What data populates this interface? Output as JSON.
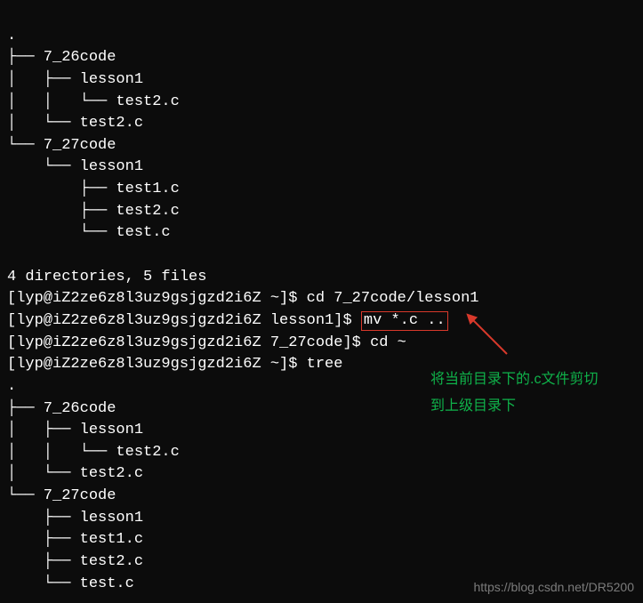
{
  "tree_top": {
    "root": ".",
    "lines": [
      "├── 7_26code",
      "│   ├── lesson1",
      "│   │   └── test2.c",
      "│   └── test2.c",
      "└── 7_27code",
      "    └── lesson1",
      "        ├── test1.c",
      "        ├── test2.c",
      "        └── test.c"
    ]
  },
  "summary1": "4 directories, 5 files",
  "prompt1_full": "[lyp@iZ2ze6z8l3uz9gsjgzd2i6Z ~]$ ",
  "cmd1": "cd 7_27code/lesson1",
  "prompt2_full": "[lyp@iZ2ze6z8l3uz9gsjgzd2i6Z lesson1]$ ",
  "cmd2": "mv *.c ..",
  "prompt3_full": "[lyp@iZ2ze6z8l3uz9gsjgzd2i6Z 7_27code]$ ",
  "cmd3": "cd ~",
  "prompt4_full": "[lyp@iZ2ze6z8l3uz9gsjgzd2i6Z ~]$ ",
  "cmd4": "tree",
  "tree_bottom": {
    "root": ".",
    "lines": [
      "├── 7_26code",
      "│   ├── lesson1",
      "│   │   └── test2.c",
      "│   └── test2.c",
      "└── 7_27code",
      "    ├── lesson1",
      "    ├── test1.c",
      "    ├── test2.c",
      "    └── test.c"
    ]
  },
  "annotation": {
    "line1": "将当前目录下的.c文件剪切",
    "line2": "到上级目录下"
  },
  "watermark": "https://blog.csdn.net/DR5200"
}
